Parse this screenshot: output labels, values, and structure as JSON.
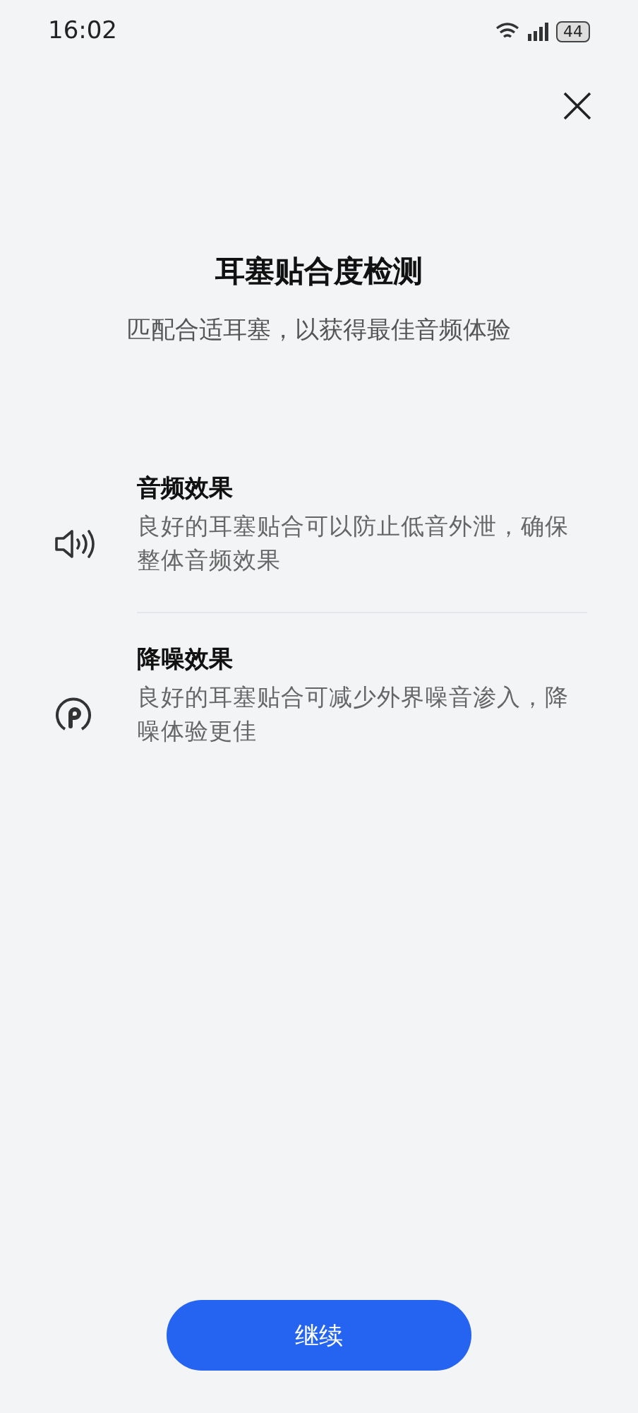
{
  "status_bar": {
    "time": "16:02",
    "battery": "44"
  },
  "title": "耳塞贴合度检测",
  "subtitle": "匹配合适耳塞，以获得最佳音频体验",
  "features": [
    {
      "kind": "audio",
      "title": "音频效果",
      "description": "良好的耳塞贴合可以防止低音外泄，确保整体音频效果"
    },
    {
      "kind": "noise",
      "title": "降噪效果",
      "description": "良好的耳塞贴合可减少外界噪音渗入，降噪体验更佳"
    }
  ],
  "button": "继续"
}
